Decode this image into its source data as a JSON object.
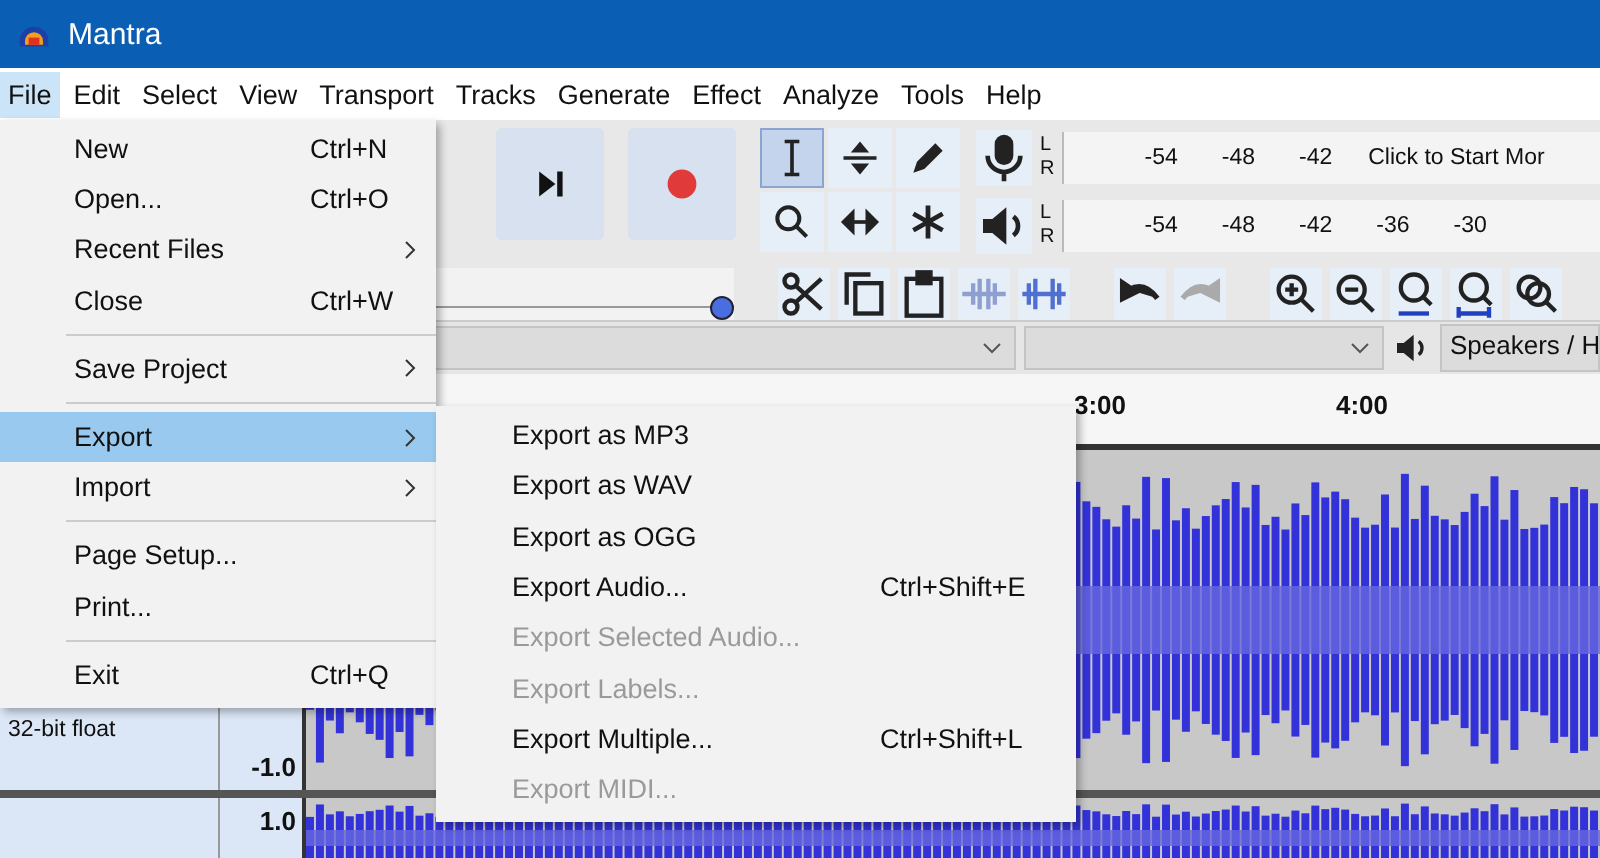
{
  "window": {
    "title": "Mantra"
  },
  "menu_bar": [
    {
      "label": "File",
      "selected": true
    },
    {
      "label": "Edit",
      "selected": false
    },
    {
      "label": "Select",
      "selected": false
    },
    {
      "label": "View",
      "selected": false
    },
    {
      "label": "Transport",
      "selected": false
    },
    {
      "label": "Tracks",
      "selected": false
    },
    {
      "label": "Generate",
      "selected": false
    },
    {
      "label": "Effect",
      "selected": false
    },
    {
      "label": "Analyze",
      "selected": false
    },
    {
      "label": "Tools",
      "selected": false
    },
    {
      "label": "Help",
      "selected": false
    }
  ],
  "tools": [
    {
      "kind": "ibeam",
      "selected": true
    },
    {
      "kind": "envelope",
      "selected": false
    },
    {
      "kind": "pencil",
      "selected": false
    },
    {
      "kind": "zoom",
      "selected": false
    },
    {
      "kind": "timeshift",
      "selected": false
    },
    {
      "kind": "multi",
      "selected": false
    }
  ],
  "meters": [
    {
      "kind": "record",
      "channels": [
        "L",
        "R"
      ],
      "ticks": [
        "-54",
        "-48",
        "-42"
      ],
      "note": "Click to Start Mor"
    },
    {
      "kind": "play",
      "channels": [
        "L",
        "R"
      ],
      "ticks": [
        "-54",
        "-48",
        "-42",
        "-36",
        "-30"
      ]
    }
  ],
  "speed_slider": {
    "level": 1.0
  },
  "device_bar": {
    "output_device": "Speakers / H"
  },
  "ruler": {
    "labels": [
      "3:00",
      "4:00"
    ]
  },
  "tracks": [
    {
      "info": "32-bit float",
      "scale": [
        "-1.0"
      ]
    },
    {
      "scale": [
        "1.0"
      ]
    }
  ],
  "file_menu": {
    "items": [
      {
        "kind": "item",
        "label": "New",
        "shortcut": "Ctrl+N",
        "selected": false
      },
      {
        "kind": "item",
        "label": "Open...",
        "shortcut": "Ctrl+O",
        "selected": false
      },
      {
        "kind": "submenu",
        "label": "Recent Files",
        "selected": false
      },
      {
        "kind": "item",
        "label": "Close",
        "shortcut": "Ctrl+W",
        "selected": false
      },
      {
        "kind": "separator"
      },
      {
        "kind": "submenu",
        "label": "Save Project",
        "selected": false
      },
      {
        "kind": "separator"
      },
      {
        "kind": "submenu",
        "label": "Export",
        "selected": true
      },
      {
        "kind": "submenu",
        "label": "Import",
        "selected": false
      },
      {
        "kind": "separator"
      },
      {
        "kind": "item",
        "label": "Page Setup...",
        "selected": false
      },
      {
        "kind": "item",
        "label": "Print...",
        "selected": false
      },
      {
        "kind": "separator"
      },
      {
        "kind": "item",
        "label": "Exit",
        "shortcut": "Ctrl+Q",
        "selected": false
      }
    ]
  },
  "export_submenu": {
    "items": [
      {
        "label": "Export as MP3",
        "disabled": false
      },
      {
        "label": "Export as WAV",
        "disabled": false
      },
      {
        "label": "Export as OGG",
        "disabled": false
      },
      {
        "label": "Export Audio...",
        "shortcut": "Ctrl+Shift+E",
        "disabled": false
      },
      {
        "label": "Export Selected Audio...",
        "disabled": true
      },
      {
        "label": "Export Labels...",
        "disabled": true
      },
      {
        "label": "Export Multiple...",
        "shortcut": "Ctrl+Shift+L",
        "disabled": false
      },
      {
        "label": "Export MIDI...",
        "disabled": true
      }
    ]
  }
}
